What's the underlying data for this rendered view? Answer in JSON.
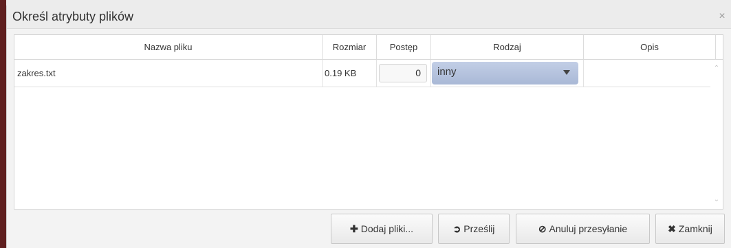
{
  "dialog": {
    "title": "Określ atrybuty plików",
    "close_glyph": "×"
  },
  "table": {
    "columns": [
      "Nazwa pliku",
      "Rozmiar",
      "Postęp",
      "Rodzaj",
      "Opis"
    ],
    "rows": [
      {
        "name": "zakres.txt",
        "size": "0.19 KB",
        "progress": "0",
        "type": "inny",
        "description": ""
      }
    ]
  },
  "buttons": {
    "add": {
      "icon": "plus-icon",
      "glyph": "✚",
      "label": "Dodaj pliki..."
    },
    "send": {
      "icon": "circle-arrow-right-icon",
      "glyph": "➲",
      "label": "Prześlij"
    },
    "cancel": {
      "icon": "ban-icon",
      "glyph": "⊘",
      "label": "Anuluj przesyłanie"
    },
    "close": {
      "icon": "x-icon",
      "glyph": "✖",
      "label": "Zamknij"
    }
  },
  "scroll": {
    "up_glyph": "⌃",
    "down_glyph": "⌄"
  }
}
